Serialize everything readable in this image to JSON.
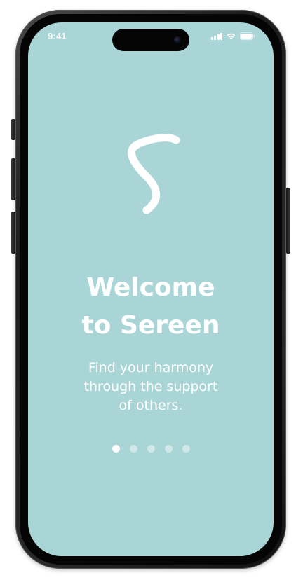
{
  "status_bar": {
    "time": "9:41",
    "icons": [
      "signal-icon",
      "wifi-icon",
      "battery-icon"
    ]
  },
  "onboarding": {
    "logo": "sereen-s-logo",
    "title": "Welcome\nto Sereen",
    "subtitle": "Find your harmony\nthrough the support\nof others.",
    "pager": {
      "total_pages": 5,
      "current_page": 1
    }
  },
  "colors": {
    "background": "#aad5d6",
    "text": "#ffffff",
    "dot_inactive": "rgba(255,255,255,0.45)",
    "dot_active": "#ffffff"
  }
}
